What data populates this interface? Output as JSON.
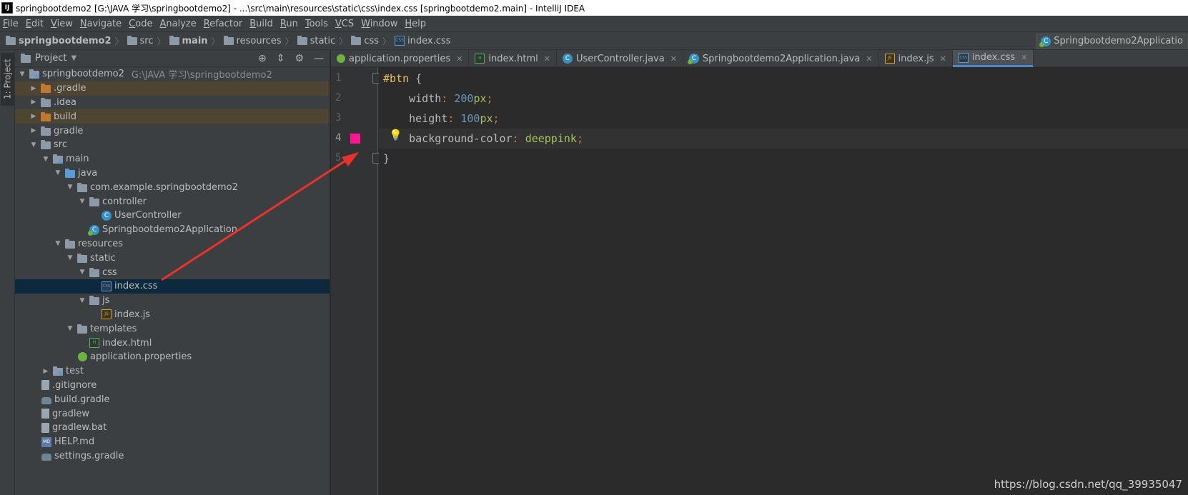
{
  "window": {
    "title": "springbootdemo2 [G:\\JAVA 学习\\springbootdemo2] - ...\\src\\main\\resources\\static\\css\\index.css [springbootdemo2.main] - IntelliJ IDEA",
    "app_icon_text": "IJ"
  },
  "menu": [
    "File",
    "Edit",
    "View",
    "Navigate",
    "Code",
    "Analyze",
    "Refactor",
    "Build",
    "Run",
    "Tools",
    "VCS",
    "Window",
    "Help"
  ],
  "breadcrumb": [
    "springbootdemo2",
    "src",
    "main",
    "resources",
    "static",
    "css",
    "index.css"
  ],
  "run_config": "Springbootdemo2Applicatio",
  "left_stripe_tab": "1: Project",
  "project_panel": {
    "title": "Project",
    "root_label": "springbootdemo2",
    "root_path": "G:\\JAVA 学习\\springbootdemo2",
    "items": [
      {
        "label": ".gradle"
      },
      {
        "label": ".idea"
      },
      {
        "label": "build"
      },
      {
        "label": "gradle"
      },
      {
        "label": "src"
      },
      {
        "label": "main"
      },
      {
        "label": "java"
      },
      {
        "label": "com.example.springbootdemo2"
      },
      {
        "label": "controller"
      },
      {
        "label": "UserController"
      },
      {
        "label": "Springbootdemo2Application"
      },
      {
        "label": "resources"
      },
      {
        "label": "static"
      },
      {
        "label": "css"
      },
      {
        "label": "index.css"
      },
      {
        "label": "js"
      },
      {
        "label": "index.js"
      },
      {
        "label": "templates"
      },
      {
        "label": "index.html"
      },
      {
        "label": "application.properties"
      },
      {
        "label": "test"
      },
      {
        "label": ".gitignore"
      },
      {
        "label": "build.gradle"
      },
      {
        "label": "gradlew"
      },
      {
        "label": "gradlew.bat"
      },
      {
        "label": "HELP.md"
      },
      {
        "label": "settings.gradle"
      }
    ]
  },
  "tabs": [
    {
      "label": "application.properties"
    },
    {
      "label": "index.html"
    },
    {
      "label": "UserController.java"
    },
    {
      "label": "Springbootdemo2Application.java"
    },
    {
      "label": "index.js"
    },
    {
      "label": "index.css"
    }
  ],
  "editor": {
    "line_numbers": [
      "1",
      "2",
      "3",
      "4",
      "5"
    ],
    "line1": {
      "selector": "#btn",
      "brace": "{"
    },
    "line2": {
      "prop": "width",
      "num": "200",
      "unit": "px"
    },
    "line3": {
      "prop": "height",
      "num": "100",
      "unit": "px"
    },
    "line4": {
      "prop": "background-color",
      "value": "deeppink"
    },
    "line5": {
      "brace": "}"
    },
    "swatch_color": "#ff1493"
  },
  "watermark": "https://blog.csdn.net/qq_39935047"
}
